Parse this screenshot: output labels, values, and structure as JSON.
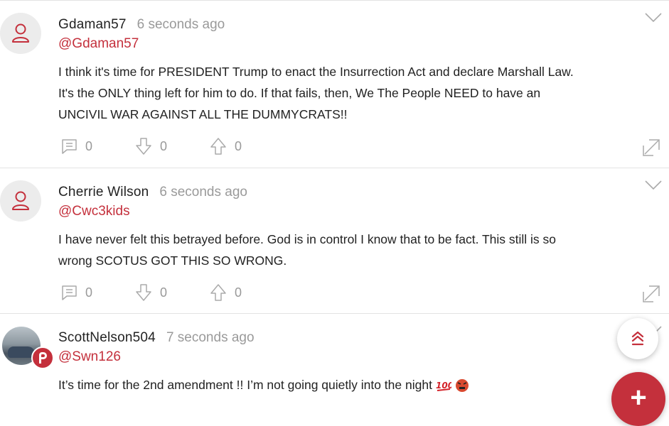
{
  "posts": [
    {
      "username": "Gdaman57",
      "time": "6 seconds ago",
      "handle": "@Gdaman57",
      "lines": [
        "I think it's time for PRESIDENT Trump to enact the Insurrection Act and declare Marshall Law.",
        "It's the ONLY thing left for him to do. If that fails, then, We The People NEED to have an",
        "UNCIVIL WAR AGAINST ALL THE DUMMYCRATS!!"
      ],
      "comments": "0",
      "downvotes": "0",
      "upvotes": "0",
      "avatar": "user-icon"
    },
    {
      "username": "Cherrie Wilson",
      "time": "6 seconds ago",
      "handle": "@Cwc3kids",
      "lines": [
        "I have never felt this betrayed before. God is in control I know that to be fact. This still is so",
        "wrong SCOTUS GOT THIS SO WRONG."
      ],
      "comments": "0",
      "downvotes": "0",
      "upvotes": "0",
      "avatar": "user-icon"
    },
    {
      "username": "ScottNelson504",
      "time": "7 seconds ago",
      "handle": "@Swn126",
      "lines": [
        "It’s time for the 2nd amendment !! I’m not going quietly into the night"
      ],
      "emojis": [
        "100",
        "angry-face"
      ],
      "avatar": "photo",
      "badge": "P"
    }
  ],
  "colors": {
    "accent": "#c4303c",
    "muted": "#9a9a9a",
    "divider": "#e3e3e3"
  },
  "fab_add_label": "+"
}
